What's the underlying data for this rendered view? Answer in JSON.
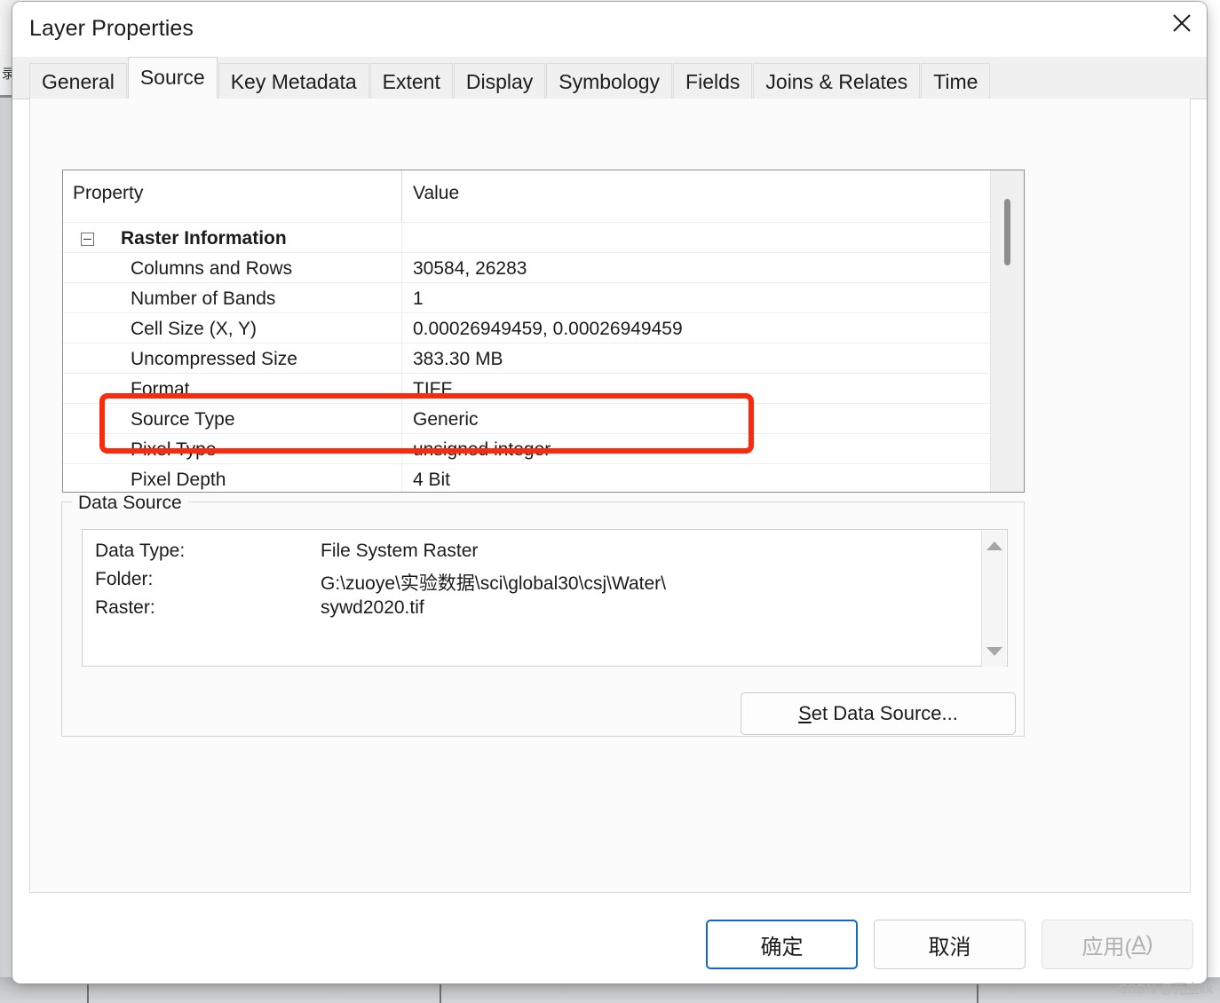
{
  "background": {
    "toc_tab_label": "录",
    "bottom_separator_positions": [
      98,
      495,
      1100
    ]
  },
  "dialog": {
    "title": "Layer Properties",
    "close_icon": "close-icon"
  },
  "tabs": [
    {
      "label": "General",
      "active": false
    },
    {
      "label": "Source",
      "active": true
    },
    {
      "label": "Key Metadata",
      "active": false
    },
    {
      "label": "Extent",
      "active": false
    },
    {
      "label": "Display",
      "active": false
    },
    {
      "label": "Symbology",
      "active": false
    },
    {
      "label": "Fields",
      "active": false
    },
    {
      "label": "Joins & Relates",
      "active": false
    },
    {
      "label": "Time",
      "active": false
    }
  ],
  "property_grid": {
    "headers": {
      "property": "Property",
      "value": "Value"
    },
    "rows": [
      {
        "name": "Raster Information",
        "value": "",
        "type": "group",
        "expanded": true
      },
      {
        "name": "Columns and Rows",
        "value": "30584, 26283",
        "type": "item"
      },
      {
        "name": "Number of Bands",
        "value": "1",
        "type": "item"
      },
      {
        "name": "Cell Size (X, Y)",
        "value": "0.00026949459, 0.00026949459",
        "type": "item",
        "highlighted": true
      },
      {
        "name": "Uncompressed Size",
        "value": "383.30 MB",
        "type": "item"
      },
      {
        "name": "Format",
        "value": "TIFF",
        "type": "item"
      },
      {
        "name": "Source Type",
        "value": "Generic",
        "type": "item"
      },
      {
        "name": "Pixel Type",
        "value": "unsigned integer",
        "type": "item"
      },
      {
        "name": "Pixel Depth",
        "value": "4 Bit",
        "type": "item"
      }
    ]
  },
  "data_source": {
    "group_label": "Data Source",
    "fields": [
      {
        "label": "Data Type:",
        "value": "File System Raster"
      },
      {
        "label": "Folder:",
        "value": "G:\\zuoye\\实验数据\\sci\\global30\\csj\\Water\\"
      },
      {
        "label": "Raster:",
        "value": "sywd2020.tif"
      }
    ],
    "set_data_source_button": {
      "mnemonic": "S",
      "rest": "et Data Source..."
    }
  },
  "footer": {
    "ok_label": "确定",
    "cancel_label": "取消",
    "apply_prefix": "应用(",
    "apply_mnemonic": "A",
    "apply_suffix": ")"
  },
  "watermark": "CSDN @元宝kk",
  "colors": {
    "accent": "#0f6cbd",
    "highlight_red": "#fc2a0d",
    "panel_bg": "#fbfbfb",
    "grid_border": "#8a8d91"
  }
}
